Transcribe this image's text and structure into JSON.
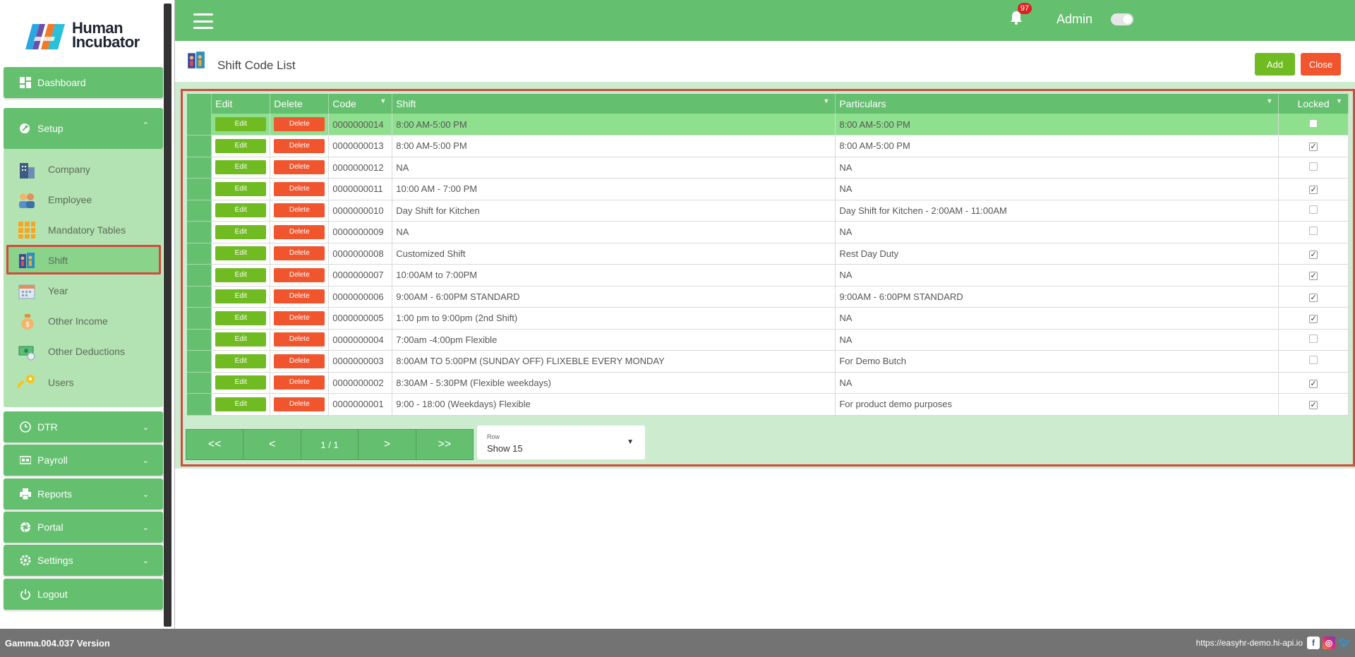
{
  "app": {
    "logo_text_line1": "Human",
    "logo_text_line2": "Incubator"
  },
  "sidebar": {
    "dashboard": "Dashboard",
    "setup": "Setup",
    "setup_items": [
      {
        "label": "Company",
        "icon": "building-icon"
      },
      {
        "label": "Employee",
        "icon": "people-icon"
      },
      {
        "label": "Mandatory Tables",
        "icon": "grid-icon"
      },
      {
        "label": "Shift",
        "icon": "shift-icon"
      },
      {
        "label": "Year",
        "icon": "calendar-icon"
      },
      {
        "label": "Other Income",
        "icon": "money-bag-icon"
      },
      {
        "label": "Other Deductions",
        "icon": "cash-icon"
      },
      {
        "label": "Users",
        "icon": "key-icon"
      }
    ],
    "sections": [
      {
        "label": "DTR",
        "icon": "clock-icon"
      },
      {
        "label": "Payroll",
        "icon": "payroll-icon"
      },
      {
        "label": "Reports",
        "icon": "printer-icon"
      },
      {
        "label": "Portal",
        "icon": "aperture-icon"
      },
      {
        "label": "Settings",
        "icon": "gear-icon"
      }
    ],
    "logout": "Logout"
  },
  "topbar": {
    "notification_count": "97",
    "user": "Admin"
  },
  "page": {
    "title": "Shift Code List",
    "add_label": "Add",
    "close_label": "Close"
  },
  "grid": {
    "columns": [
      "Edit",
      "Delete",
      "Code",
      "Shift",
      "Particulars",
      "Locked"
    ],
    "edit_label": "Edit",
    "delete_label": "Delete",
    "rows": [
      {
        "code": "0000000014",
        "shift": "8:00 AM-5:00 PM",
        "particulars": "8:00 AM-5:00 PM",
        "locked": false,
        "active": true
      },
      {
        "code": "0000000013",
        "shift": "8:00 AM-5:00 PM",
        "particulars": "8:00 AM-5:00 PM",
        "locked": true
      },
      {
        "code": "0000000012",
        "shift": "NA",
        "particulars": "NA",
        "locked": false
      },
      {
        "code": "0000000011",
        "shift": "10:00 AM - 7:00 PM",
        "particulars": "NA",
        "locked": true
      },
      {
        "code": "0000000010",
        "shift": "Day Shift for Kitchen",
        "particulars": "Day Shift for Kitchen - 2:00AM - 11:00AM",
        "locked": false
      },
      {
        "code": "0000000009",
        "shift": "NA",
        "particulars": "NA",
        "locked": false
      },
      {
        "code": "0000000008",
        "shift": "Customized Shift",
        "particulars": "Rest Day Duty",
        "locked": true
      },
      {
        "code": "0000000007",
        "shift": "10:00AM to 7:00PM",
        "particulars": "NA",
        "locked": true
      },
      {
        "code": "0000000006",
        "shift": "9:00AM - 6:00PM STANDARD",
        "particulars": "9:00AM - 6:00PM STANDARD",
        "locked": true
      },
      {
        "code": "0000000005",
        "shift": "1:00 pm to 9:00pm (2nd Shift)",
        "particulars": "NA",
        "locked": true
      },
      {
        "code": "0000000004",
        "shift": "7:00am -4:00pm Flexible",
        "particulars": "NA",
        "locked": false
      },
      {
        "code": "0000000003",
        "shift": "8:00AM TO 5:00PM (SUNDAY OFF) FLIXEBLE EVERY MONDAY",
        "particulars": "For Demo Butch",
        "locked": false
      },
      {
        "code": "0000000002",
        "shift": "8:30AM - 5:30PM (Flexible weekdays)",
        "particulars": "NA",
        "locked": true
      },
      {
        "code": "0000000001",
        "shift": "9:00 - 18:00 (Weekdays) Flexible",
        "particulars": "For product demo purposes",
        "locked": true
      }
    ]
  },
  "pager": {
    "first": "<<",
    "prev": "<",
    "info": "1 / 1",
    "next": ">",
    "last": ">>",
    "rows_label": "Row",
    "rows_value": "Show 15"
  },
  "footer": {
    "version": "Gamma.004.037 Version",
    "url": "https://easyhr-demo.hi-api.io"
  },
  "colors": {
    "primary": "#64bf6f",
    "panel": "#b4e3b3",
    "edit": "#6fbb21",
    "delete": "#f0552e",
    "highlight": "#d14b3d"
  }
}
